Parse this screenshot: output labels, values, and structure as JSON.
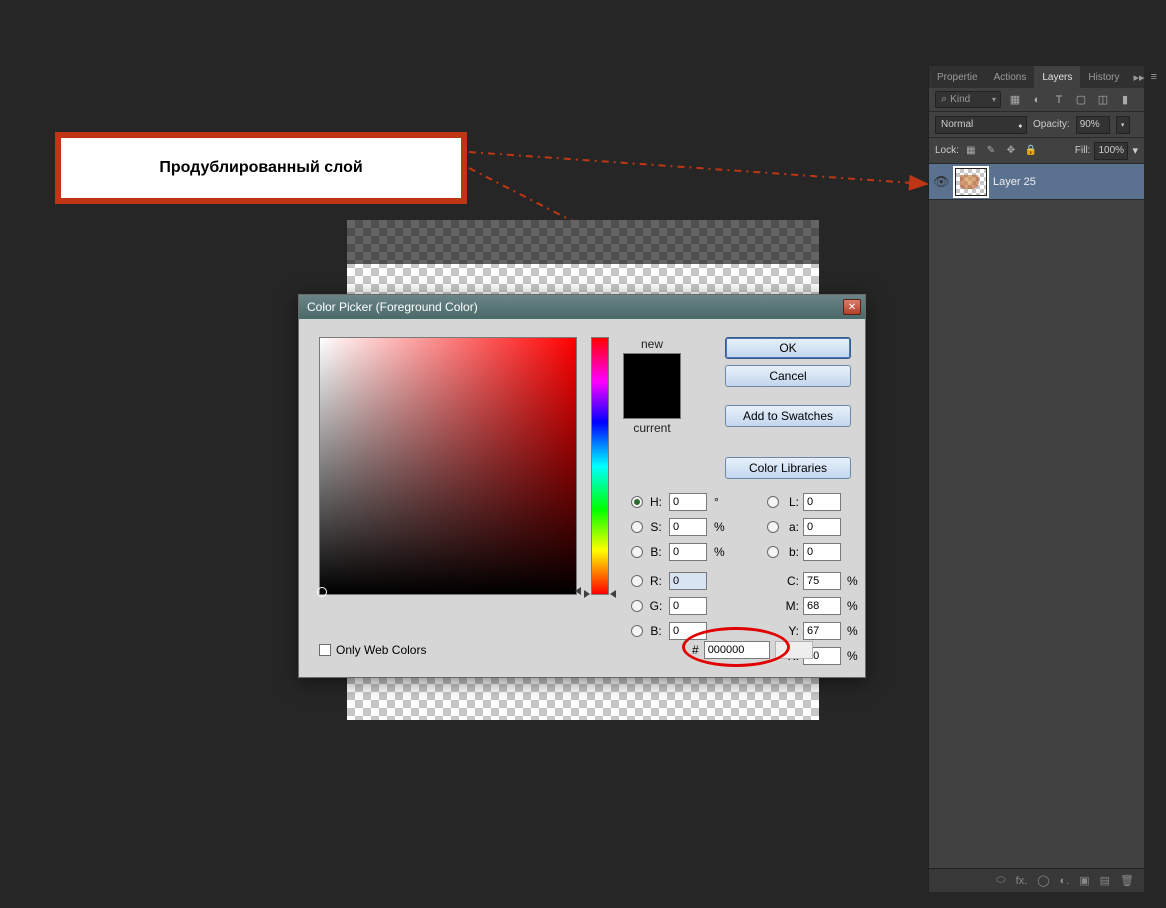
{
  "annotation": {
    "text": "Продублированный слой"
  },
  "dialog": {
    "title": "Color Picker (Foreground Color)",
    "new_label": "new",
    "current_label": "current",
    "buttons": {
      "ok": "OK",
      "cancel": "Cancel",
      "add_swatches": "Add to Swatches",
      "color_libs": "Color Libraries"
    },
    "only_web": "Only Web Colors",
    "hsb": {
      "h_label": "H:",
      "s_label": "S:",
      "b_label": "B:",
      "h": "0",
      "s": "0",
      "b": "0",
      "deg": "°",
      "pct": "%"
    },
    "rgb": {
      "r_label": "R:",
      "g_label": "G:",
      "b_label": "B:",
      "r": "0",
      "g": "0",
      "b": "0"
    },
    "lab": {
      "l_label": "L:",
      "a_label": "a:",
      "b_label": "b:",
      "l": "0",
      "a": "0",
      "b": "0"
    },
    "cmyk": {
      "c_label": "C:",
      "m_label": "M:",
      "y_label": "Y:",
      "k_label": "K:",
      "c": "75",
      "m": "68",
      "y": "67",
      "k": "90",
      "pct": "%"
    },
    "hex": {
      "hash": "#",
      "value": "000000"
    }
  },
  "layers_panel": {
    "tabs": {
      "properties": "Propertie",
      "actions": "Actions",
      "layers": "Layers",
      "history": "History"
    },
    "kind": "Kind",
    "blend_mode": "Normal",
    "opacity_label": "Opacity:",
    "opacity_value": "90%",
    "lock_label": "Lock:",
    "fill_label": "Fill:",
    "fill_value": "100%",
    "layer_name": "Layer 25",
    "footer_icons": {
      "link": "⬭",
      "fx": "fx.",
      "mask": "◯",
      "adj": "◐.",
      "group": "▣",
      "new": "▤",
      "trash": "🗑"
    }
  }
}
